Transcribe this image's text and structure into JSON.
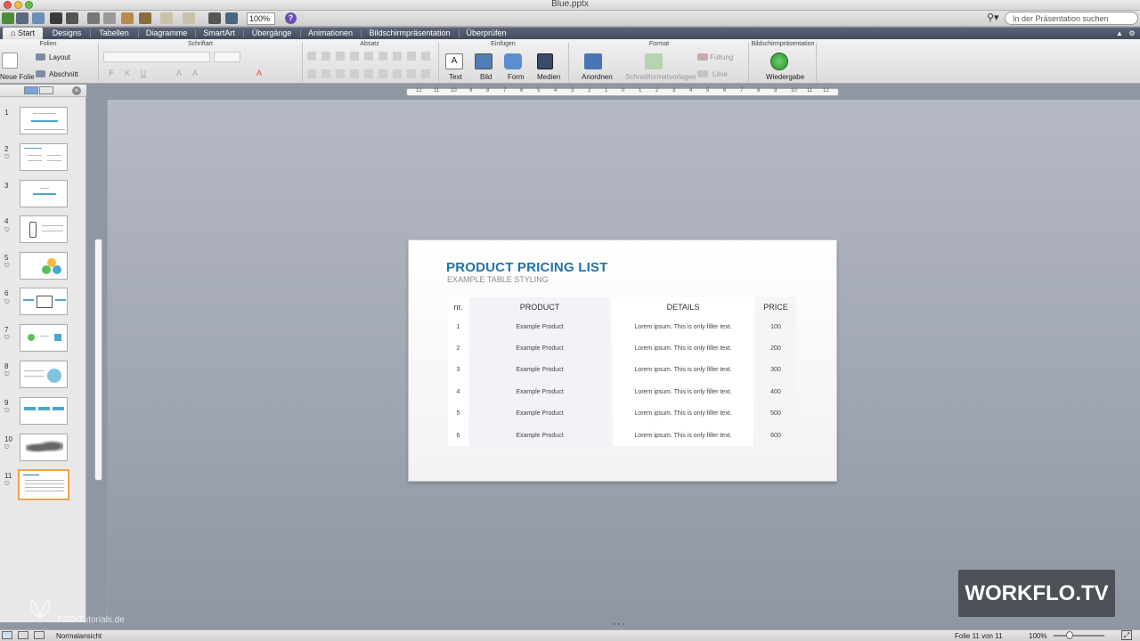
{
  "window": {
    "title": "Blue.pptx"
  },
  "toolbar": {
    "zoom": "100%",
    "help": "?",
    "search_placeholder": "In der Präsentation suchen"
  },
  "tabs": [
    {
      "label": "Start",
      "active": true
    },
    {
      "label": "Designs"
    },
    {
      "label": "Tabellen"
    },
    {
      "label": "Diagramme"
    },
    {
      "label": "SmartArt"
    },
    {
      "label": "Übergänge"
    },
    {
      "label": "Animationen"
    },
    {
      "label": "Bildschirmpräsentation"
    },
    {
      "label": "Überprüfen"
    }
  ],
  "ribbon": {
    "groups": {
      "folien": "Folien",
      "schriftart": "Schriftart",
      "absatz": "Absatz",
      "einfuegen": "Einfügen",
      "format": "Format",
      "bildschirm": "Bildschirmpräsentation"
    },
    "new_slide": "Neue Folie",
    "layout": "Layout",
    "section": "Abschnitt",
    "text": "Text",
    "picture": "Bild",
    "shape": "Form",
    "media": "Medien",
    "arrange": "Anordnen",
    "quick_styles": "Schnellformatvorlagen",
    "fill": "Füllung",
    "line": "Linie",
    "play": "Wiedergabe"
  },
  "ruler": {
    "h_ticks": [
      "12",
      "11",
      "10",
      "9",
      "8",
      "7",
      "6",
      "5",
      "4",
      "3",
      "2",
      "1",
      "0",
      "1",
      "2",
      "3",
      "4",
      "5",
      "6",
      "7",
      "8",
      "9",
      "10",
      "11",
      "12"
    ]
  },
  "slides": [
    {
      "num": "1"
    },
    {
      "num": "2"
    },
    {
      "num": "3"
    },
    {
      "num": "4"
    },
    {
      "num": "5"
    },
    {
      "num": "6"
    },
    {
      "num": "7"
    },
    {
      "num": "8"
    },
    {
      "num": "9"
    },
    {
      "num": "10"
    },
    {
      "num": "11",
      "selected": true
    }
  ],
  "slide": {
    "title": "PRODUCT PRICING LIST",
    "subtitle": "EXAMPLE TABLE STYLING",
    "headers": [
      "nr.",
      "PRODUCT",
      "DETAILS",
      "PRICE"
    ],
    "rows": [
      {
        "nr": "1",
        "product": "Example Product",
        "details": "Lorem ipsum. This is only filler text.",
        "price": "100"
      },
      {
        "nr": "2",
        "product": "Example Product",
        "details": "Lorem ipsum. This is only filler text.",
        "price": "200"
      },
      {
        "nr": "3",
        "product": "Example Product",
        "details": "Lorem ipsum. This is only filler text.",
        "price": "300"
      },
      {
        "nr": "4",
        "product": "Example Product",
        "details": "Lorem ipsum. This is only filler text.",
        "price": "400"
      },
      {
        "nr": "5",
        "product": "Example Product",
        "details": "Lorem ipsum. This is only filler text.",
        "price": "500"
      },
      {
        "nr": "6",
        "product": "Example Product",
        "details": "Lorem ipsum. This is only filler text.",
        "price": "600"
      }
    ]
  },
  "status": {
    "view": "Normalansicht",
    "slide_info": "Folie 11 von 11",
    "zoom": "100%"
  },
  "watermark": {
    "brand": "WORKFLO.TV",
    "psd": "PSD-Tutorials.de"
  },
  "colors": {
    "accent": "#1f74a8",
    "selection": "#f0a44b",
    "tab_bar": "#4c5466"
  }
}
